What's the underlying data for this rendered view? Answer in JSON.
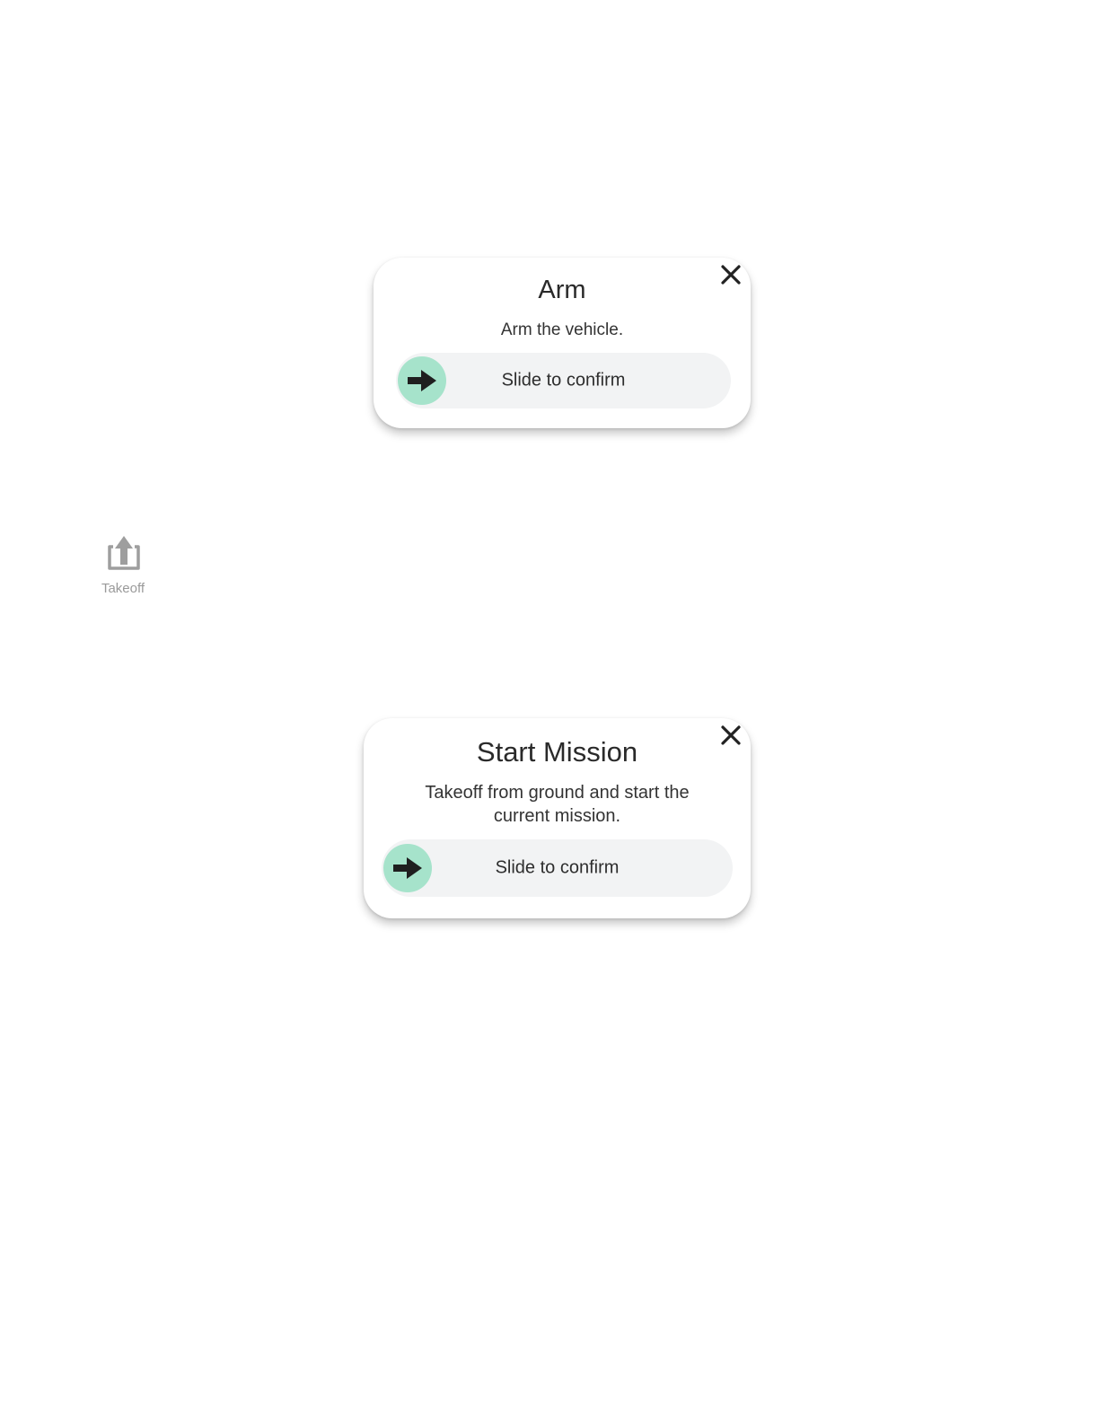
{
  "arm_dialog": {
    "title": "Arm",
    "description": "Arm the vehicle.",
    "slider_label": "Slide to confirm"
  },
  "toolbar": {
    "takeoff_label": "Takeoff"
  },
  "mission_dialog": {
    "title": "Start Mission",
    "description_line1": "Takeoff from ground and start the",
    "description_line2": "current mission.",
    "slider_label": "Slide to confirm"
  },
  "icons": {
    "close": "close-icon",
    "slider_thumb": "arrow-right-icon",
    "takeoff": "takeoff-icon"
  },
  "colors": {
    "slider_thumb": "#a6e3cb",
    "slider_track": "#f2f3f4",
    "tool_icon": "#9e9e9e"
  }
}
